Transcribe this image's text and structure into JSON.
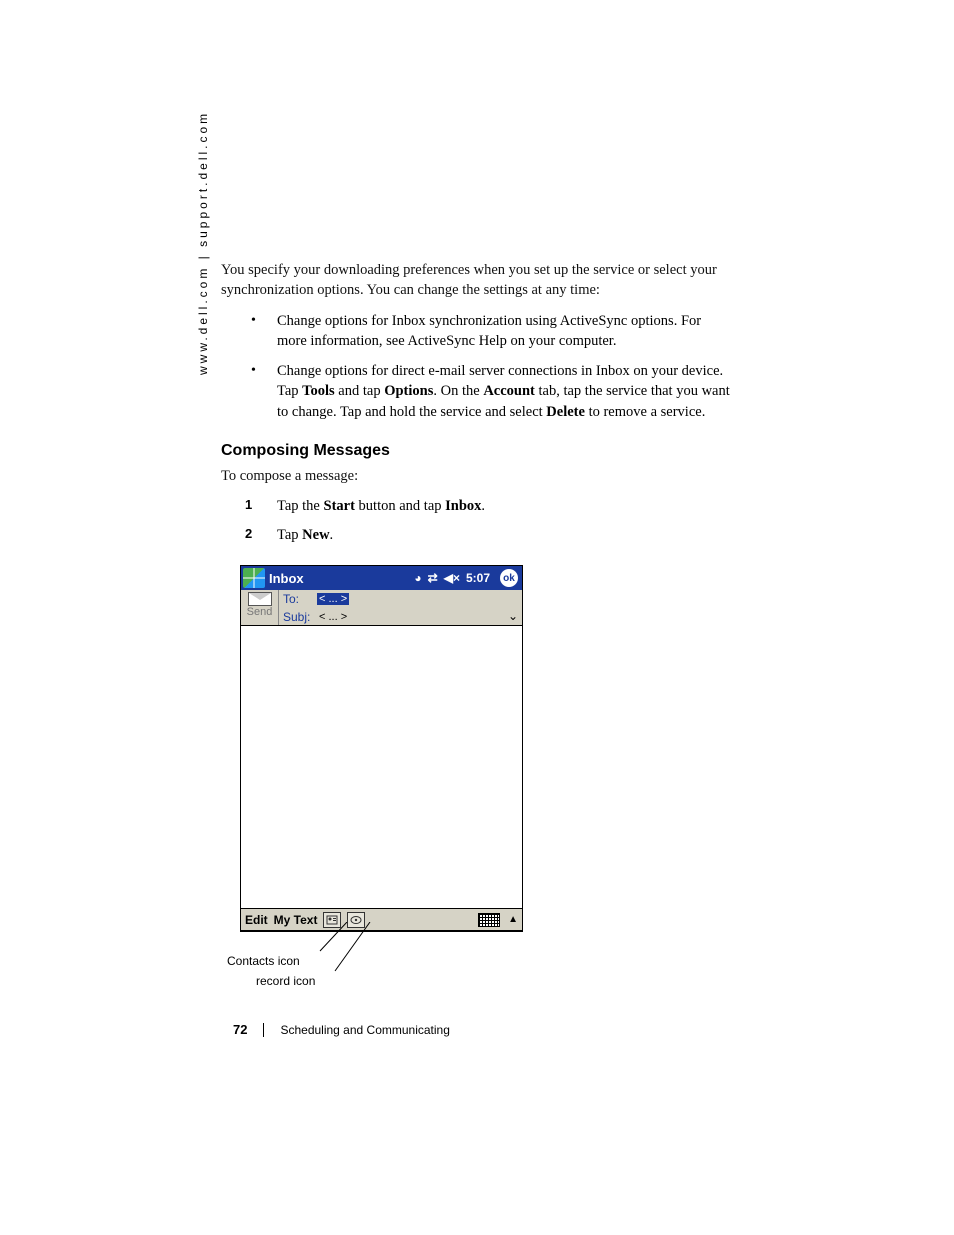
{
  "sidebar_url": "www.dell.com | support.dell.com",
  "intro_para": "You specify your downloading preferences when you set up the service or select your synchronization options. You can change the settings at any time:",
  "bullets": [
    "Change options for Inbox synchronization using ActiveSync options. For more information, see ActiveSync Help on your computer.",
    {
      "pre": "Change options for direct e-mail server connections in Inbox on your device. Tap ",
      "b1": "Tools",
      "mid1": " and tap ",
      "b2": "Options",
      "mid2": ". On the ",
      "b3": "Account",
      "mid3": " tab, tap the service that you want to change. Tap and hold the service and select ",
      "b4": "Delete",
      "post": " to remove a service."
    }
  ],
  "heading": "Composing Messages",
  "intro2": "To compose a message:",
  "steps": [
    {
      "num": "1",
      "pre": "Tap the ",
      "b1": "Start",
      "mid": " button and tap ",
      "b2": "Inbox",
      "post": "."
    },
    {
      "num": "2",
      "pre": "Tap ",
      "b1": "New",
      "post": "."
    }
  ],
  "device": {
    "title": "Inbox",
    "time": "5:07",
    "ok": "ok",
    "send": "Send",
    "to_label": "To:",
    "to_value": "< ... >",
    "subj_label": "Subj:",
    "subj_value": "< ... >",
    "bottom": {
      "edit": "Edit",
      "mytext": "My Text"
    }
  },
  "callouts": {
    "contacts": "Contacts icon",
    "record": "record icon"
  },
  "footer": {
    "page": "72",
    "section": "Scheduling and Communicating"
  }
}
